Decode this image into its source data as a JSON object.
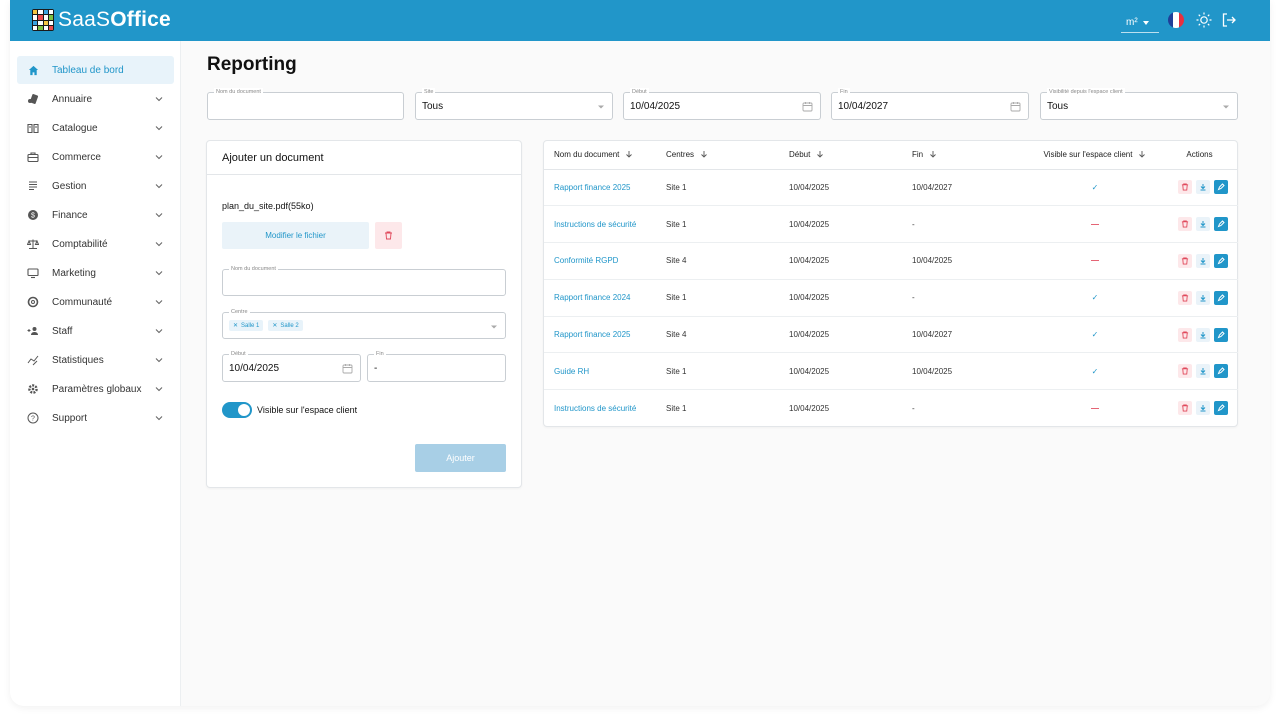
{
  "app": {
    "logo_prefix": "SaaS",
    "logo_bold": "Office"
  },
  "topbar": {
    "unit": "m²"
  },
  "sidebar": {
    "items": [
      {
        "label": "Tableau de bord",
        "icon": "home-icon",
        "active": true
      },
      {
        "label": "Annuaire",
        "icon": "contacts-icon"
      },
      {
        "label": "Catalogue",
        "icon": "book-icon"
      },
      {
        "label": "Commerce",
        "icon": "briefcase-icon"
      },
      {
        "label": "Gestion",
        "icon": "list-icon"
      },
      {
        "label": "Finance",
        "icon": "dollar-icon"
      },
      {
        "label": "Comptabilité",
        "icon": "scale-icon"
      },
      {
        "label": "Marketing",
        "icon": "monitor-icon"
      },
      {
        "label": "Communauté",
        "icon": "community-icon"
      },
      {
        "label": "Staff",
        "icon": "add-user-icon"
      },
      {
        "label": "Statistiques",
        "icon": "chart-icon"
      },
      {
        "label": "Paramètres globaux",
        "icon": "gear-icon"
      },
      {
        "label": "Support",
        "icon": "help-icon"
      }
    ]
  },
  "page": {
    "title": "Reporting"
  },
  "filters": {
    "name_label": "Nom du document",
    "name_value": "",
    "site_label": "Site",
    "site_value": "Tous",
    "start_label": "Début",
    "start_value": "10/04/2025",
    "end_label": "Fin",
    "end_value": "10/04/2027",
    "visibility_label": "Visibilité depuis l'espace client",
    "visibility_value": "Tous"
  },
  "add_form": {
    "title": "Ajouter un document",
    "file_name": "plan_du_site.pdf(55ko)",
    "modify_label": "Modifier le fichier",
    "name_label": "Nom du document",
    "centre_label": "Centre",
    "centres": [
      "Salle 1",
      "Salle 2"
    ],
    "start_label": "Début",
    "start_value": "10/04/2025",
    "end_label": "Fin",
    "end_value": "-",
    "visible_label": "Visible sur l'espace client",
    "submit_label": "Ajouter"
  },
  "table": {
    "headers": {
      "name": "Nom du document",
      "centres": "Centres",
      "start": "Début",
      "end": "Fin",
      "visible": "Visible sur l'espace client",
      "actions": "Actions"
    },
    "rows": [
      {
        "name": "Rapport finance 2025",
        "centre": "Site 1",
        "start": "10/04/2025",
        "end": "10/04/2027",
        "visible": true
      },
      {
        "name": "Instructions de sécurité",
        "centre": "Site 1",
        "start": "10/04/2025",
        "end": "-",
        "visible": false
      },
      {
        "name": "Conformité RGPD",
        "centre": "Site 4",
        "start": "10/04/2025",
        "end": "10/04/2025",
        "visible": false
      },
      {
        "name": "Rapport finance 2024",
        "centre": "Site 1",
        "start": "10/04/2025",
        "end": "-",
        "visible": true
      },
      {
        "name": "Rapport finance 2025",
        "centre": "Site 4",
        "start": "10/04/2025",
        "end": "10/04/2027",
        "visible": true
      },
      {
        "name": "Guide RH",
        "centre": "Site 1",
        "start": "10/04/2025",
        "end": "10/04/2025",
        "visible": true
      },
      {
        "name": "Instructions de sécurité",
        "centre": "Site 1",
        "start": "10/04/2025",
        "end": "-",
        "visible": false
      }
    ]
  },
  "colors": {
    "primary": "#2196c9",
    "danger": "#e0475a",
    "danger_bg": "#fde8ea",
    "light_bg": "#eaf3f9"
  }
}
